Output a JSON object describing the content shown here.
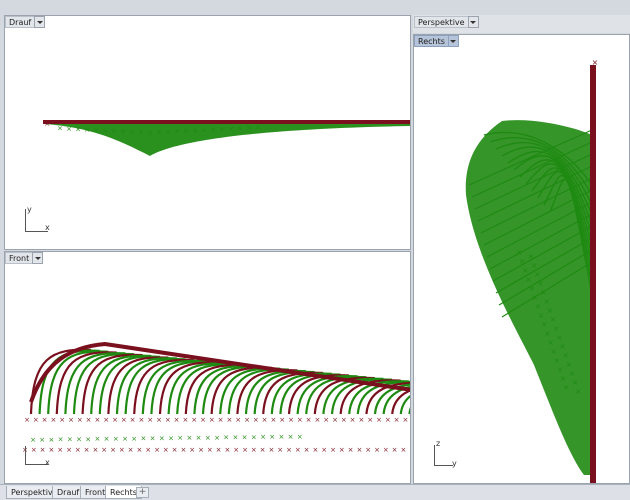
{
  "viewports": {
    "top": {
      "label": "Drauf",
      "axis_v": "y",
      "axis_h": "x"
    },
    "front": {
      "label": "Front",
      "axis_v": "",
      "axis_h": "x"
    },
    "perspective": {
      "label": "Perspektive"
    },
    "right": {
      "label": "Rechts",
      "axis_v": "z",
      "axis_h": "y"
    }
  },
  "tabs": [
    {
      "label": "Perspektive",
      "active": false
    },
    {
      "label": "Drauf",
      "active": false
    },
    {
      "label": "Front",
      "active": false
    },
    {
      "label": "Rechts",
      "active": true
    }
  ],
  "tab_add_label": "+",
  "marker_glyph": "×",
  "colors": {
    "green": "#1f8a12",
    "red": "#7a0f1e",
    "active_tab": "#b5c4d8"
  },
  "icons": {
    "dropdown": "chevron-down-icon",
    "axis": "axis-gizmo-icon",
    "add": "plus-icon"
  }
}
